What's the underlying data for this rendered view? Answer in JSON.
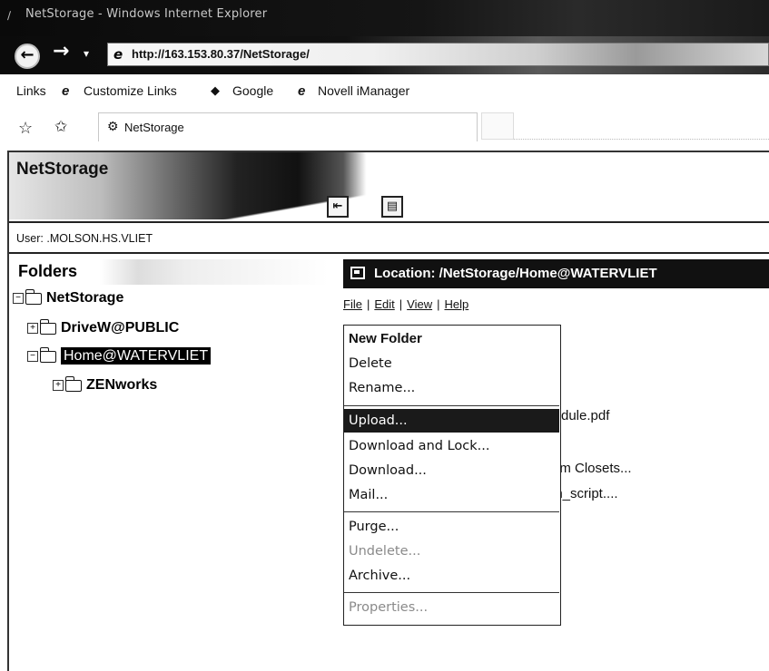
{
  "browser": {
    "window_title": "NetStorage - Windows Internet Explorer",
    "url": "http://163.153.80.37/NetStorage/",
    "links_bar": [
      "Links",
      "Customize Links",
      "Google",
      "Novell iManager"
    ],
    "tab_label": "NetStorage"
  },
  "app": {
    "title": "NetStorage",
    "user_label": "User:",
    "user_value": ".MOLSON.HS.VLIET",
    "folders_heading": "Folders",
    "location_prefix": "Location:",
    "location_path": "/NetStorage/Home@WATERVLIET"
  },
  "tree": [
    {
      "label": "NetStorage",
      "expanded": true,
      "selected": false
    },
    {
      "label": "DriveW@PUBLIC",
      "expanded": false,
      "selected": false
    },
    {
      "label": "Home@WATERVLIET",
      "expanded": true,
      "selected": true
    },
    {
      "label": "ZENworks",
      "expanded": false,
      "selected": false
    }
  ],
  "menubar": [
    "File",
    "Edit",
    "View",
    "Help"
  ],
  "file_menu": [
    {
      "label": "New Folder",
      "enabled": true,
      "highlighted": false
    },
    {
      "label": "Delete",
      "enabled": true,
      "highlighted": false
    },
    {
      "label": "Rename...",
      "enabled": true,
      "highlighted": false
    },
    {
      "label": "Upload...",
      "enabled": true,
      "highlighted": true
    },
    {
      "label": "Download and Lock...",
      "enabled": true,
      "highlighted": false
    },
    {
      "label": "Download...",
      "enabled": true,
      "highlighted": false
    },
    {
      "label": "Mail...",
      "enabled": true,
      "highlighted": false
    },
    {
      "label": "Purge...",
      "enabled": true,
      "highlighted": false
    },
    {
      "label": "Undelete...",
      "enabled": false,
      "highlighted": false
    },
    {
      "label": "Archive...",
      "enabled": true,
      "highlighted": false
    },
    {
      "label": "Properties...",
      "enabled": false,
      "highlighted": false
    }
  ],
  "background_files": [
    "dule.pdf",
    "em Closets...",
    "in_script...."
  ]
}
